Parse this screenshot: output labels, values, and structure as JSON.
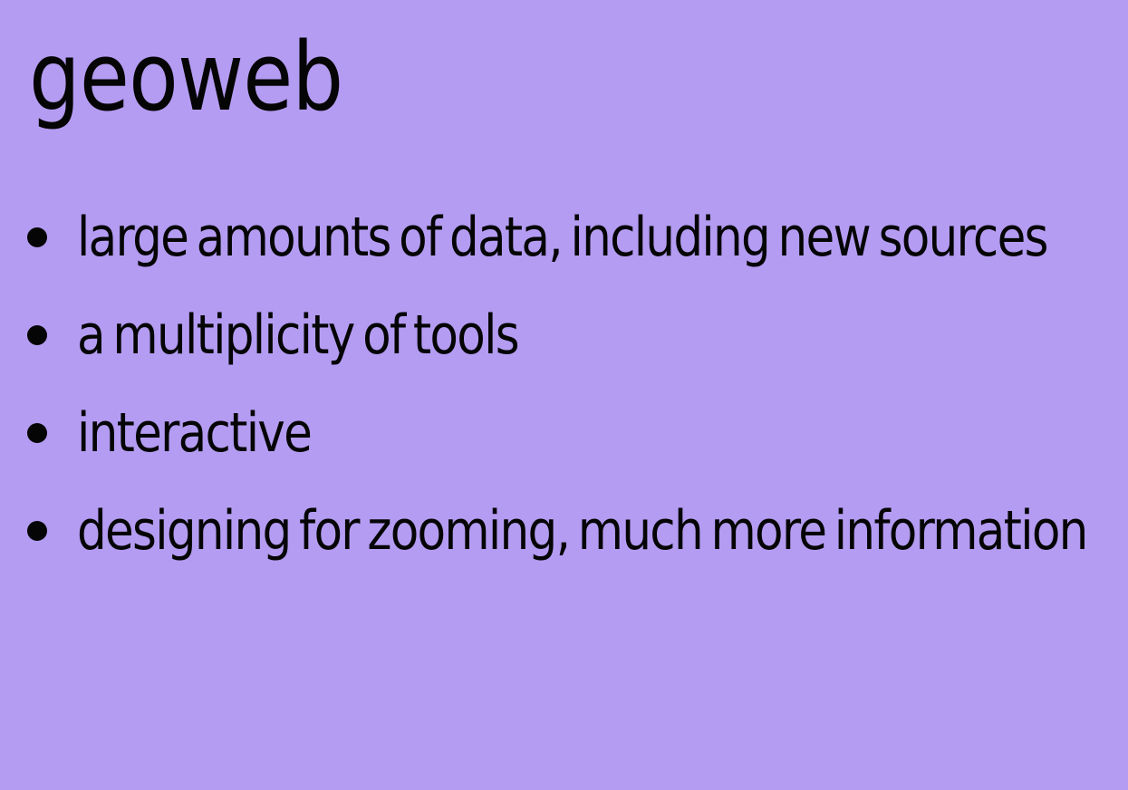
{
  "slide": {
    "title": "geoweb",
    "bullets": [
      {
        "text": "large amounts of data, including new sources"
      },
      {
        "text": "a multiplicity of tools"
      },
      {
        "text": "interactive"
      },
      {
        "text": "designing for zooming, much more information"
      }
    ]
  },
  "colors": {
    "background": "#b49cf2",
    "text": "#050505"
  }
}
